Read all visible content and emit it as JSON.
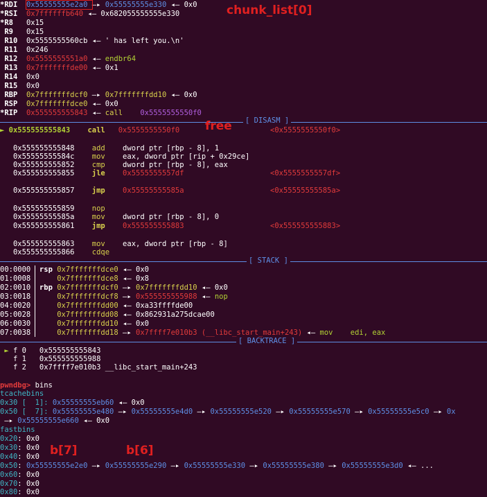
{
  "registers": {
    "rdi_name": "*RDI",
    "rdi_val": "0x55555555e2a0",
    "rdi_arrow": " —▸ ",
    "rdi_ptr": "0x55555555e330",
    "rdi_tail": " ◂— 0x0",
    "rsi_name": "*RSI",
    "rsi_val": "0x7ffffffb640",
    "rsi_tail": " ◂— 0x682055555555e330",
    "r8_name": "*R8",
    "r8_val": "0x15",
    "r9_name": "R9",
    "r9_val": "0x15",
    "r10_name": "R10",
    "r10_val": "0x5555555560cb",
    "r10_tail": " ◂— ' has left you.\\n'",
    "r11_name": "R11",
    "r11_val": "0x246",
    "r12_name": "R12",
    "r12_val": "0x5555555551a0",
    "r12_tail_a": " ◂— ",
    "r12_tail_b": "endbr64",
    "r13_name": "R13",
    "r13_val": "0x7fffffffde00",
    "r13_tail": " ◂— 0x1",
    "r14_name": "R14",
    "r14_val": "0x0",
    "r15_name": "R15",
    "r15_val": "0x0",
    "rbp_name": "RBP",
    "rbp_val": "0x7fffffffdcf0",
    "rbp_arrow": " —▸ ",
    "rbp_ptr": "0x7fffffffdd10",
    "rbp_tail": " ◂— 0x0",
    "rsp_name": "RSP",
    "rsp_val": "0x7fffffffdce0",
    "rsp_tail": " ◂— 0x0",
    "rip_name": "*RIP",
    "rip_val": "0x555555555843",
    "rip_tail_a": " ◂— ",
    "rip_tail_b": "call",
    "rip_tail_c": "0x5555555550f0"
  },
  "sections": {
    "disasm": "[ DISASM ]",
    "stack": "[ STACK ]",
    "backtrace": "[ BACKTRACE ]"
  },
  "disasm": {
    "cur_marker": "►",
    "l0_addr": "0x555555555843",
    "l0_op": "call",
    "l0_arg": "0x5555555550f0",
    "l0_ref": "<0x5555555550f0>",
    "l1_addr": "0x555555555848",
    "l1_op": "add",
    "l1_arg": "dword ptr [rbp - 8], 1",
    "l2_addr": "0x55555555584c",
    "l2_op": "mov",
    "l2_arg": "eax, dword ptr [rip + 0x29ce]",
    "l3_addr": "0x555555555852",
    "l3_op": "cmp",
    "l3_arg": "dword ptr [rbp - 8], eax",
    "l4_addr": "0x555555555855",
    "l4_op": "jle",
    "l4_arg": "0x5555555557df",
    "l4_ref": "<0x5555555557df>",
    "l5_addr": "0x555555555857",
    "l5_op": "jmp",
    "l5_arg": "0x55555555585a",
    "l5_ref": "<0x55555555585a>",
    "l6_addr": "0x555555555859",
    "l6_op": "nop",
    "l7_addr": "0x55555555585a",
    "l7_op": "mov",
    "l7_arg": "dword ptr [rbp - 8], 0",
    "l8_addr": "0x555555555861",
    "l8_op": "jmp",
    "l8_arg": "0x555555555883",
    "l8_ref": "<0x555555555883>",
    "l9_addr": "0x555555555863",
    "l9_op": "mov",
    "l9_arg": "eax, dword ptr [rbp - 8]",
    "l10_addr": "0x555555555866",
    "l10_op": "cdqe"
  },
  "stack": {
    "s0_idx": "00:0000",
    "s0_reg": "rsp",
    "s0_addr": "0x7fffffffdce0",
    "s0_tail": " ◂— 0x0",
    "s1_idx": "01:0008",
    "s1_addr": "0x7fffffffdce8",
    "s1_tail": " ◂— 0x8",
    "s2_idx": "02:0010",
    "s2_reg": "rbp",
    "s2_addr": "0x7fffffffdcf0",
    "s2_arrow": " —▸ ",
    "s2_ptr": "0x7fffffffdd10",
    "s2_tail": " ◂— 0x0",
    "s3_idx": "03:0018",
    "s3_addr": "0x7fffffffdcf8",
    "s3_arrow": " —▸ ",
    "s3_ptr": "0x555555555988",
    "s3_tail_a": " ◂— ",
    "s3_tail_b": "nop",
    "s4_idx": "04:0020",
    "s4_addr": "0x7fffffffdd00",
    "s4_tail": " ◂— 0xa33ffffde00",
    "s5_idx": "05:0028",
    "s5_addr": "0x7fffffffdd08",
    "s5_tail": " ◂— 0x862931a275dcae00",
    "s6_idx": "06:0030",
    "s6_addr": "0x7fffffffdd10",
    "s6_tail": " ◂— 0x0",
    "s7_idx": "07:0038",
    "s7_addr": "0x7fffffffdd18",
    "s7_arrow": " —▸ ",
    "s7_ptr": "0x7ffff7e010b3 (__libc_start_main+243)",
    "s7_tail_a": " ◂— ",
    "s7_tail_b": "mov    edi, eax"
  },
  "backtrace": {
    "marker": "►",
    "f0_label": "f 0",
    "f0_addr": "0x555555555843",
    "f1_label": "f 1",
    "f1_addr": "0x555555555988",
    "f2_label": "f 2",
    "f2_addr": "0x7ffff7e010b3 __libc_start_main+243"
  },
  "bins": {
    "prompt": "pwndbg>",
    "command": " bins",
    "tcache_title": "tcachebins",
    "t0_key": "0x30 [  1]: ",
    "t0_val": "0x55555555eb60",
    "t0_tail": " ◂— 0x0",
    "t1_key": "0x50 [  7]: ",
    "t1_v1": "0x55555555e480",
    "t1_v2": "0x55555555e4d0",
    "t1_v3": "0x55555555e520",
    "t1_v4": "0x55555555e570",
    "t1_v5": "0x55555555e5c0",
    "t1_v6": "0x",
    "t1c_v1": "0x55555555e660",
    "t1c_tail": " ◂— 0x0",
    "arrow": " —▸ ",
    "fast_title": "fastbins",
    "f20_key": "0x20",
    "f20_val": ": 0x0",
    "f30_key": "0x30",
    "f30_val": ": 0x0",
    "f40_key": "0x40",
    "f40_val": ": 0x0",
    "f50_key": "0x50",
    "f50_v1": "0x55555555e2e0",
    "f50_v2": "0x55555555e290",
    "f50_v3": "0x55555555e330",
    "f50_v4": "0x55555555e380",
    "f50_v5": "0x55555555e3d0",
    "f50_tail": " ◂— ...",
    "f60_key": "0x60",
    "f60_val": ": 0x0",
    "f70_key": "0x70",
    "f70_val": ": 0x0",
    "f80_key": "0x80",
    "f80_val": ": 0x0"
  },
  "annotations": {
    "chunk_list": "chunk_list[0]",
    "free": "free",
    "b7": "b[7]",
    "b6": "b[6]"
  },
  "colors": {
    "background": "#300a24",
    "red": "#e33b3b",
    "blue": "#5e8fe6",
    "green": "#b2d235",
    "yellow": "#d8d04c",
    "magenta": "#b25fe0",
    "cyan": "#3fb7c6",
    "annotation": "#e02020"
  }
}
